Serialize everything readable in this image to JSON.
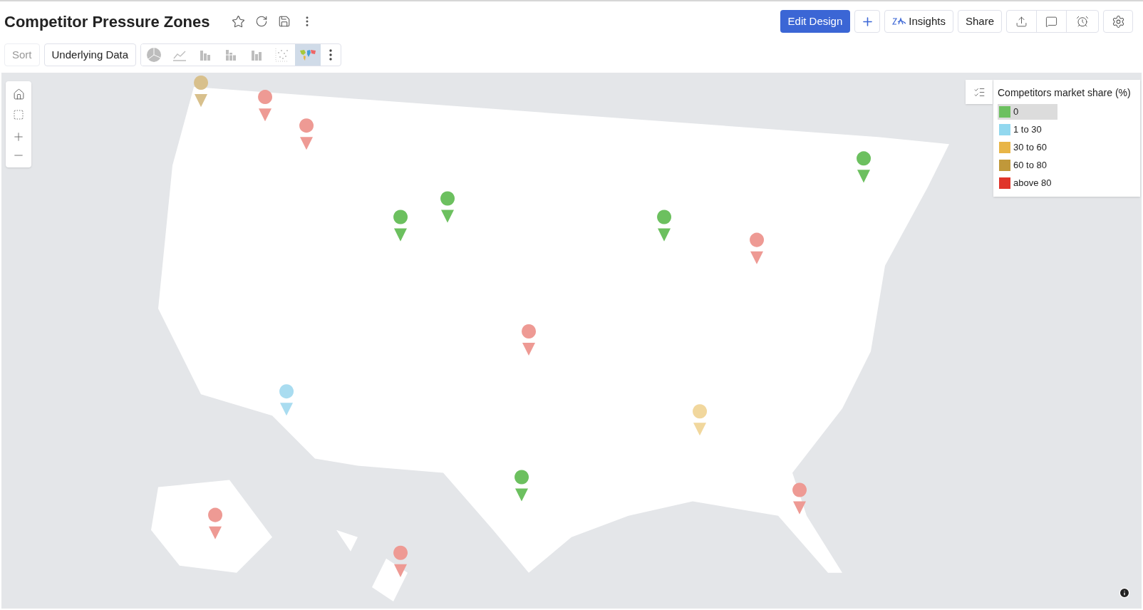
{
  "title": "Competitor Pressure Zones",
  "toolbar_buttons": [
    {
      "label": "Edit Design",
      "kind": "primary"
    },
    {
      "label": "Insights",
      "kind": "insights"
    },
    {
      "label": "Share",
      "kind": "plain"
    }
  ],
  "sub_toolbar": {
    "sort": {
      "label": "Sort",
      "disabled": true
    },
    "underlying_data": "Underlying Data"
  },
  "chart_types": [
    {
      "kind": "pie",
      "selected": false
    },
    {
      "kind": "line",
      "selected": false
    },
    {
      "kind": "bar",
      "selected": false
    },
    {
      "kind": "stacked",
      "selected": false
    },
    {
      "kind": "grouped",
      "selected": false
    },
    {
      "kind": "scatter",
      "selected": false
    },
    {
      "kind": "map",
      "selected": true
    }
  ],
  "legend": {
    "title": "Competitors market share (%)",
    "items": [
      {
        "label": "0",
        "color": "#6cc05f",
        "selected": true
      },
      {
        "label": "1 to 30",
        "color": "#92d8ef",
        "selected": false
      },
      {
        "label": "30 to 60",
        "color": "#e8b547",
        "selected": false
      },
      {
        "label": "60 to 80",
        "color": "#c0983a",
        "selected": false
      },
      {
        "label": "above 80",
        "color": "#e0352b",
        "selected": false
      }
    ]
  }
}
